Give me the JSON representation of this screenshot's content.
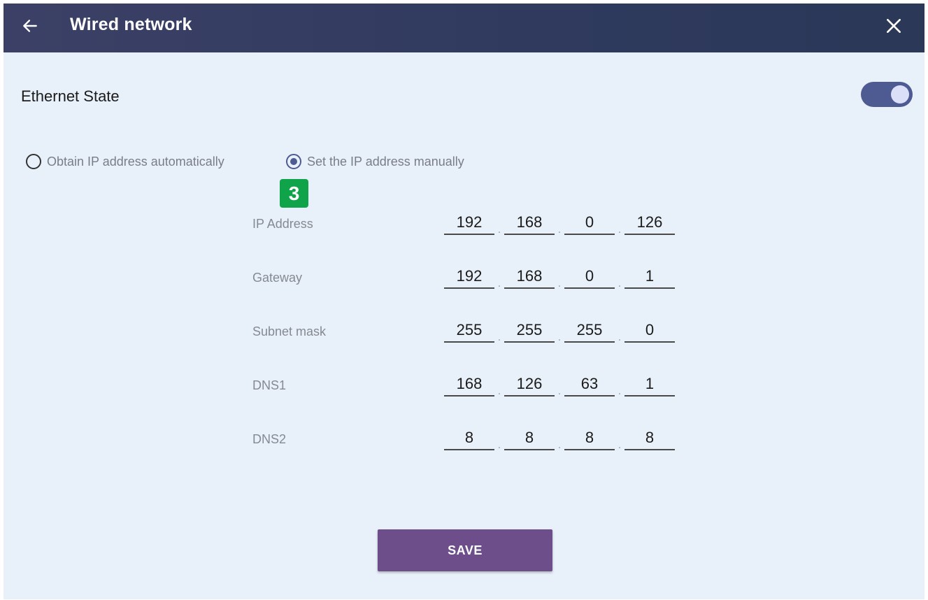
{
  "header": {
    "title": "Wired network",
    "back_icon": "arrow-left-icon",
    "close_icon": "close-icon"
  },
  "ethernet": {
    "label": "Ethernet State",
    "enabled": true
  },
  "ip_mode": {
    "options": [
      {
        "label": "Obtain IP address automatically",
        "selected": false
      },
      {
        "label": "Set the IP address manually",
        "selected": true
      }
    ]
  },
  "step_badge": "3",
  "fields": [
    {
      "label": "IP Address",
      "octets": [
        "192",
        "168",
        "0",
        "126"
      ]
    },
    {
      "label": "Gateway",
      "octets": [
        "192",
        "168",
        "0",
        "1"
      ]
    },
    {
      "label": "Subnet mask",
      "octets": [
        "255",
        "255",
        "255",
        "0"
      ]
    },
    {
      "label": "DNS1",
      "octets": [
        "168",
        "126",
        "63",
        "1"
      ]
    },
    {
      "label": "DNS2",
      "octets": [
        "8",
        "8",
        "8",
        "8"
      ]
    }
  ],
  "save_label": "SAVE",
  "colors": {
    "accent": "#4e5a92",
    "save_button": "#6d4e8b",
    "badge": "#10a44a",
    "background": "#e8f1f9"
  }
}
